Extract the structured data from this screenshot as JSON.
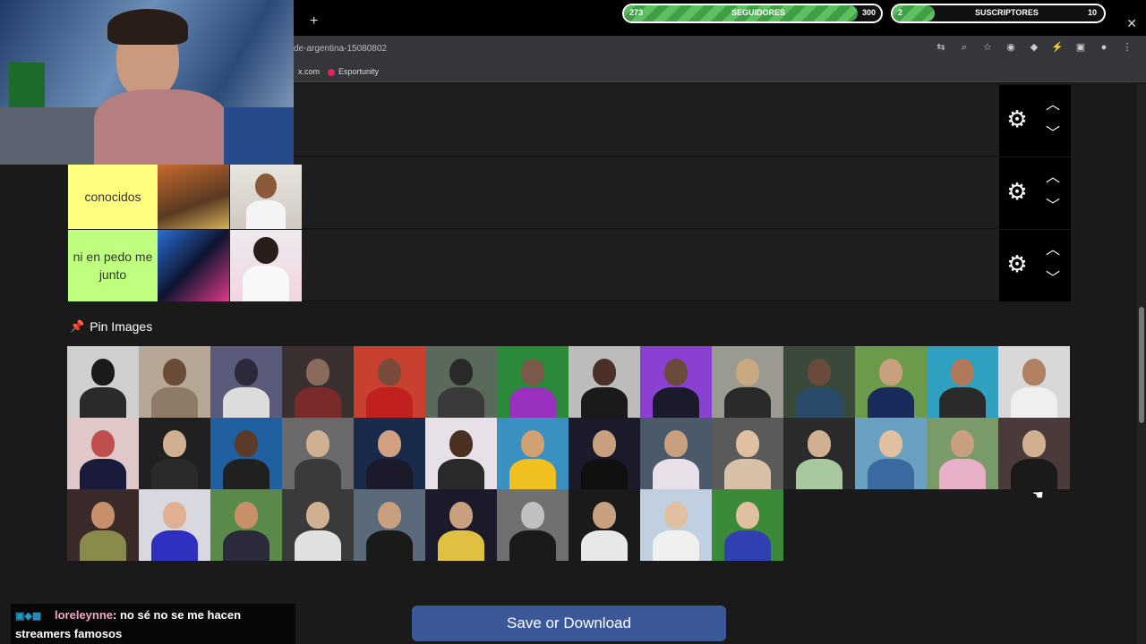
{
  "browser": {
    "new_tab_symbol": "+",
    "close_symbol": "✕",
    "url": "de-argentina-15080802",
    "bookmarks": [
      "x.com",
      "Esportunity"
    ]
  },
  "overlay": {
    "followers": {
      "current": "273",
      "label": "SEGUIDORES",
      "goal": "300",
      "progress": 0.91
    },
    "subscribers": {
      "current": "2",
      "label": "SUSCRIPTORES",
      "goal": "10",
      "progress": 0.2
    }
  },
  "tiers": [
    {
      "label": "",
      "color": "#1f1f1f",
      "images": 0
    },
    {
      "label": "conocidos",
      "color": "#ffff7f",
      "images": 2
    },
    {
      "label": "ni en pedo me junto",
      "color": "#bfff7f",
      "images": 2
    }
  ],
  "tier_controls": {
    "gear_icon": "settings-icon",
    "up_icon": "chevron-up-icon",
    "down_icon": "chevron-down-icon"
  },
  "pin_section": {
    "title": "Pin Images",
    "icon": "pushpin-icon",
    "image_count": 38
  },
  "save_button": {
    "label": "Save or Download"
  },
  "chat": {
    "user": "loreleynne",
    "message": ": no sé no se me hacen streamers famosos"
  },
  "colors": {
    "accent": "#3b5998",
    "tier_conocidos": "#ffff7f",
    "tier_ni_en_pedo": "#bfff7f",
    "bar_fill": "#5cc061"
  }
}
